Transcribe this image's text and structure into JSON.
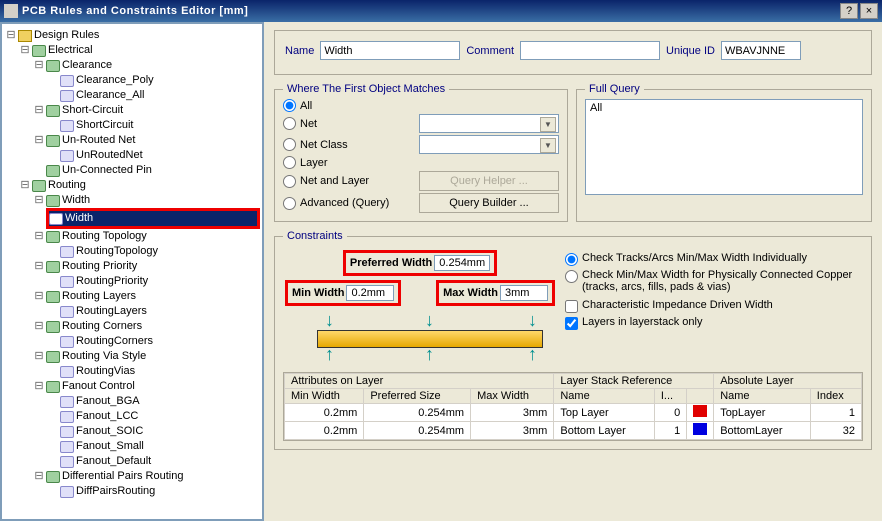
{
  "window": {
    "title": "PCB Rules and Constraints Editor [mm]"
  },
  "tree": {
    "root": "Design Rules",
    "electrical": "Electrical",
    "clearance": "Clearance",
    "clearance_poly": "Clearance_Poly",
    "clearance_all": "Clearance_All",
    "short_circuit": "Short-Circuit",
    "short_circuit_leaf": "ShortCircuit",
    "unrouted": "Un-Routed Net",
    "unrouted_leaf": "UnRoutedNet",
    "unconnected": "Un-Connected Pin",
    "routing": "Routing",
    "width": "Width",
    "width_leaf": "Width",
    "rtopo": "Routing Topology",
    "rtopo_leaf": "RoutingTopology",
    "rprio": "Routing Priority",
    "rprio_leaf": "RoutingPriority",
    "rlayers": "Routing Layers",
    "rlayers_leaf": "RoutingLayers",
    "rcorners": "Routing Corners",
    "rcorners_leaf": "RoutingCorners",
    "rvia": "Routing Via Style",
    "rvia_leaf": "RoutingVias",
    "fanout": "Fanout Control",
    "fanout_bga": "Fanout_BGA",
    "fanout_lcc": "Fanout_LCC",
    "fanout_soic": "Fanout_SOIC",
    "fanout_small": "Fanout_Small",
    "fanout_default": "Fanout_Default",
    "diffpairs": "Differential Pairs Routing",
    "diffpairs_leaf": "DiffPairsRouting"
  },
  "form": {
    "name_label": "Name",
    "name_value": "Width",
    "comment_label": "Comment",
    "comment_value": "",
    "uid_label": "Unique ID",
    "uid_value": "WBAVJNNE"
  },
  "matches": {
    "legend": "Where The First Object Matches",
    "all": "All",
    "net": "Net",
    "netclass": "Net Class",
    "layer": "Layer",
    "netlayer": "Net and Layer",
    "advanced": "Advanced (Query)",
    "helper": "Query Helper ...",
    "builder": "Query Builder ..."
  },
  "fullquery": {
    "legend": "Full Query",
    "text": "All"
  },
  "constraints": {
    "legend": "Constraints",
    "pref_label": "Preferred Width",
    "pref_val": "0.254mm",
    "min_label": "Min Width",
    "min_val": "0.2mm",
    "max_label": "Max Width",
    "max_val": "3mm",
    "chk_ind": "Check Tracks/Arcs Min/Max Width Individually",
    "chk_phys": "Check Min/Max Width for Physically Connected Copper (tracks, arcs, fills, pads & vias)",
    "chk_imp": "Characteristic Impedance Driven Width",
    "chk_stack": "Layers in layerstack only"
  },
  "table": {
    "grp_attr": "Attributes on Layer",
    "grp_stack": "Layer Stack Reference",
    "grp_abs": "Absolute Layer",
    "h_min": "Min Width",
    "h_pref": "Preferred Size",
    "h_max": "Max Width",
    "h_name": "Name",
    "h_idx": "I...",
    "h_name2": "Name",
    "h_idx2": "Index",
    "r1": {
      "min": "0.2mm",
      "pref": "0.254mm",
      "max": "3mm",
      "name": "Top Layer",
      "idx": "0",
      "color": "#e00000",
      "name2": "TopLayer",
      "idx2": "1"
    },
    "r2": {
      "min": "0.2mm",
      "pref": "0.254mm",
      "max": "3mm",
      "name": "Bottom Layer",
      "idx": "1",
      "color": "#0000e0",
      "name2": "BottomLayer",
      "idx2": "32"
    }
  }
}
